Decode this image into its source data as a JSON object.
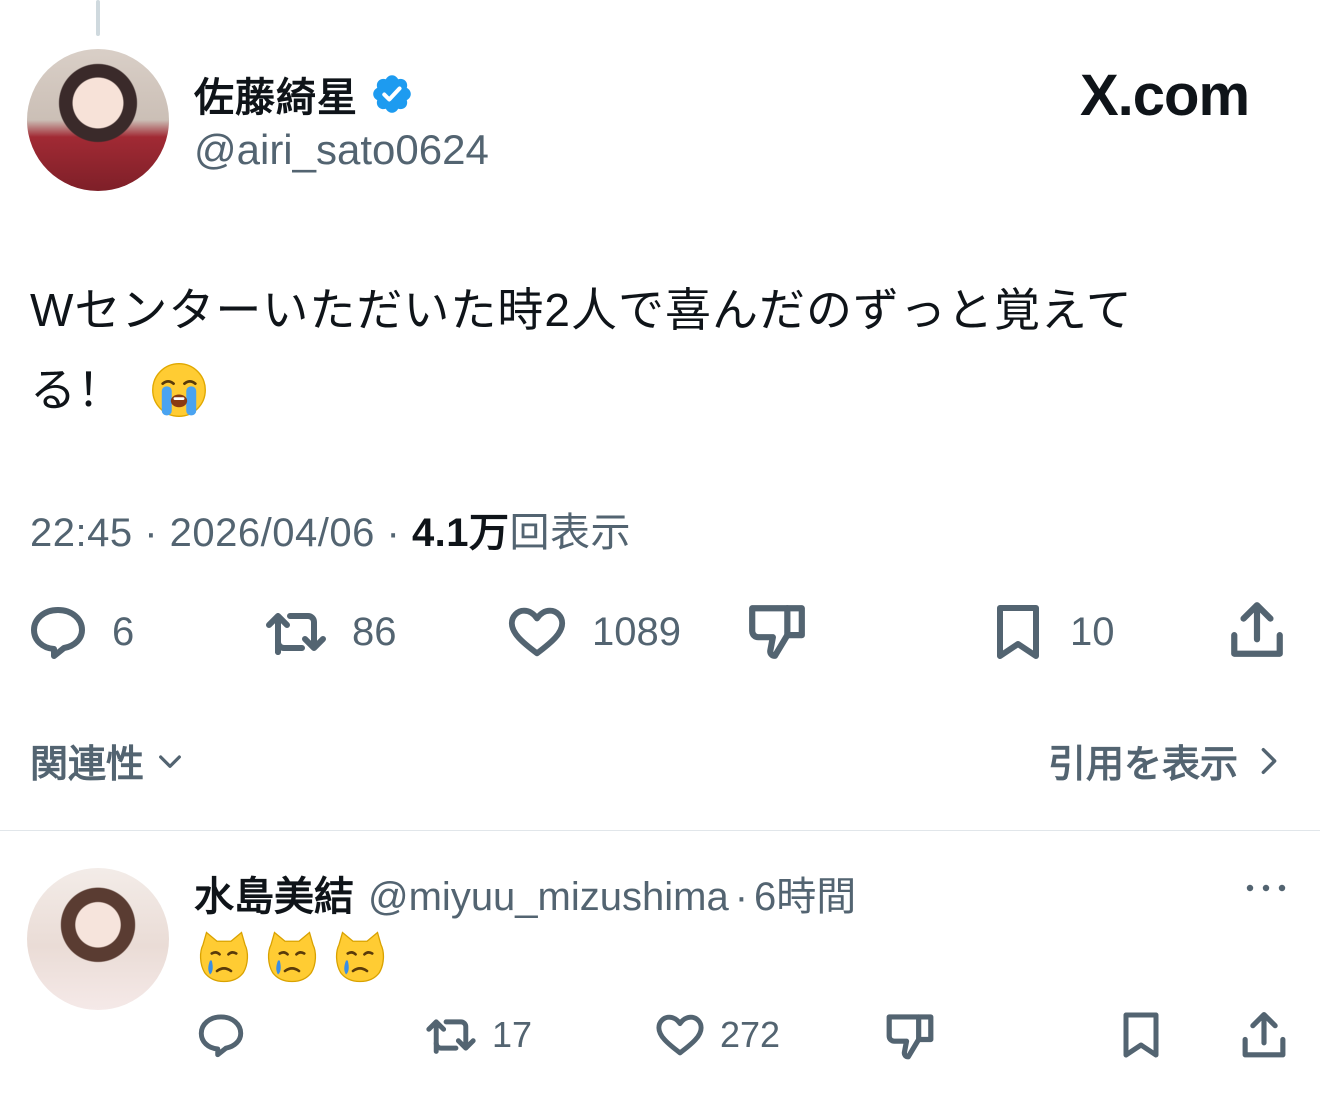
{
  "tweet": {
    "display_name": "佐藤綺星",
    "handle": "@airi_sato0624",
    "brand": "X.com",
    "text_line1": "Wセンターいただいた時2人で喜んだのずっと覚えて",
    "text_line2": "る！",
    "emoji": "loudly-crying-face",
    "time": "22:45",
    "date": "2026/04/06",
    "views_count": "4.1万",
    "views_label": "回表示",
    "actions": {
      "replies": "6",
      "reposts": "86",
      "likes": "1089",
      "bookmarks": "10"
    }
  },
  "sections": {
    "related": "関連性",
    "quotes": "引用を表示"
  },
  "reply": {
    "display_name": "水島美結",
    "handle": "@miyuu_mizushima",
    "time": "6時間",
    "emojis": [
      "crying-cat-face",
      "crying-cat-face",
      "crying-cat-face"
    ],
    "actions": {
      "reposts": "17",
      "likes": "272"
    }
  },
  "colors": {
    "text": "#0f1419",
    "secondary": "#536471",
    "verified": "#1d9bf0",
    "divider": "#e1e6ea"
  }
}
